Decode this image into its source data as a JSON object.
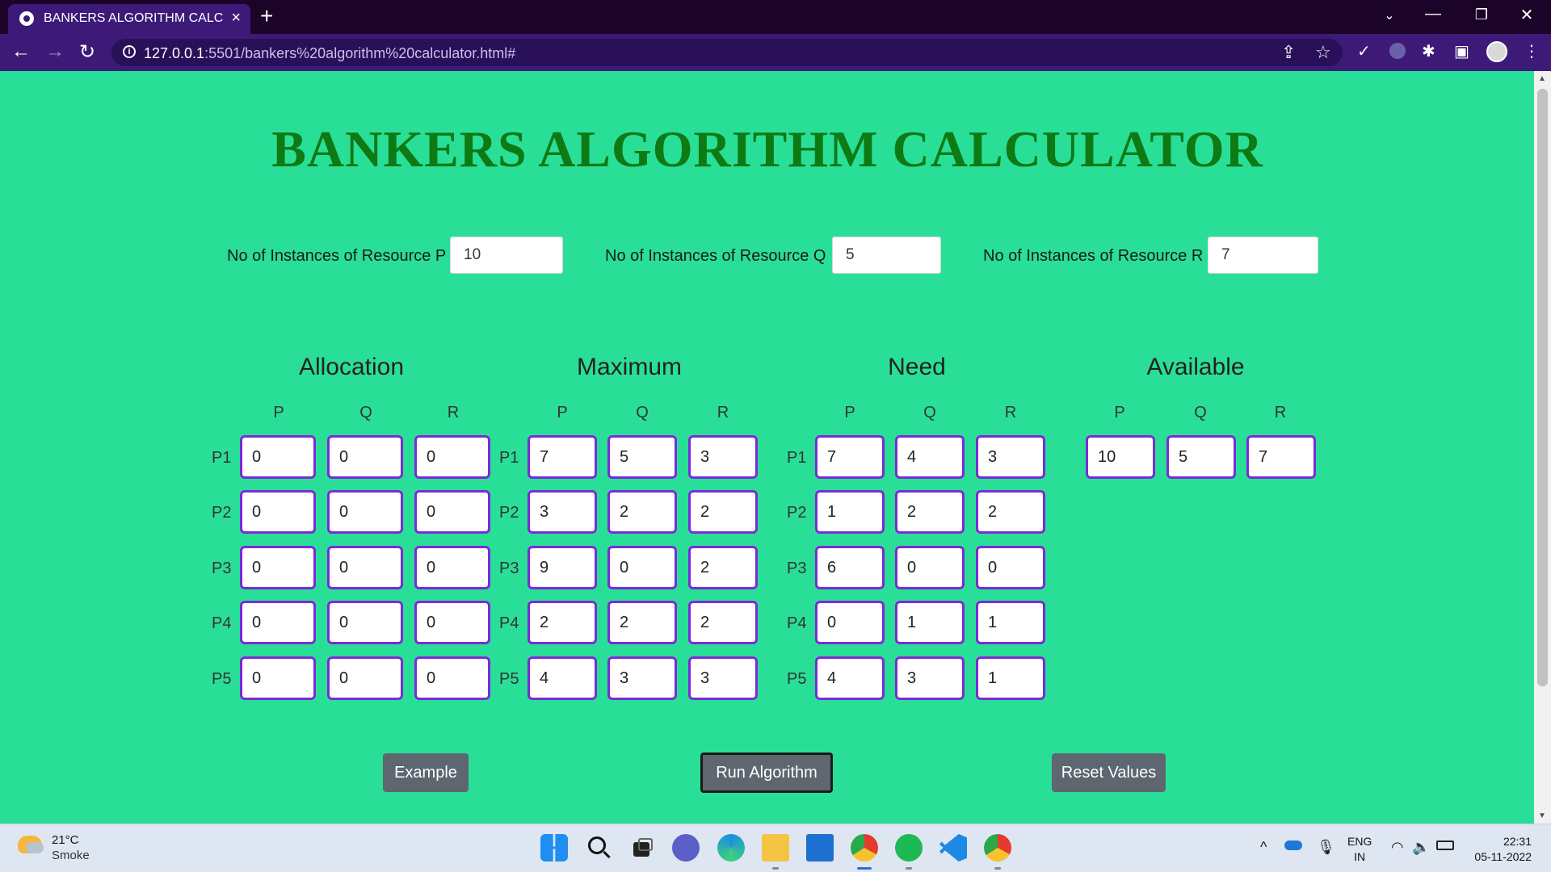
{
  "browser": {
    "tab_title": "BANKERS ALGORITHM CALCULA",
    "url_host": "127.0.0.1",
    "url_path": ":5501/bankers%20algorithm%20calculator.html#"
  },
  "page": {
    "title": "BANKERS ALGORITHM CALCULATOR",
    "resources": [
      {
        "label": "No of Instances of Resource P",
        "value": "10"
      },
      {
        "label": "No of Instances of Resource Q",
        "value": "5"
      },
      {
        "label": "No of Instances of Resource R",
        "value": "7"
      }
    ],
    "sections": [
      "Allocation",
      "Maximum",
      "Need",
      "Available"
    ],
    "columns": [
      "P",
      "Q",
      "R"
    ],
    "processes": [
      "P1",
      "P2",
      "P3",
      "P4",
      "P5"
    ],
    "allocation": [
      [
        "0",
        "0",
        "0"
      ],
      [
        "0",
        "0",
        "0"
      ],
      [
        "0",
        "0",
        "0"
      ],
      [
        "0",
        "0",
        "0"
      ],
      [
        "0",
        "0",
        "0"
      ]
    ],
    "maximum": [
      [
        "7",
        "5",
        "3"
      ],
      [
        "3",
        "2",
        "2"
      ],
      [
        "9",
        "0",
        "2"
      ],
      [
        "2",
        "2",
        "2"
      ],
      [
        "4",
        "3",
        "3"
      ]
    ],
    "need": [
      [
        "7",
        "4",
        "3"
      ],
      [
        "1",
        "2",
        "2"
      ],
      [
        "6",
        "0",
        "0"
      ],
      [
        "0",
        "1",
        "1"
      ],
      [
        "4",
        "3",
        "1"
      ]
    ],
    "available": [
      "10",
      "5",
      "7"
    ],
    "buttons": {
      "example": "Example",
      "run": "Run Algorithm",
      "reset": "Reset Values"
    }
  },
  "taskbar": {
    "temperature": "21°C",
    "condition": "Smoke",
    "lang_top": "ENG",
    "lang_bottom": "IN",
    "time": "22:31",
    "date": "05-11-2022"
  },
  "colors": {
    "page_bg": "#29df97",
    "title": "#0e7a14",
    "cell_border": "#7a2bd9",
    "button_bg": "#5e6670",
    "browser_frame": "#3d1a78"
  }
}
